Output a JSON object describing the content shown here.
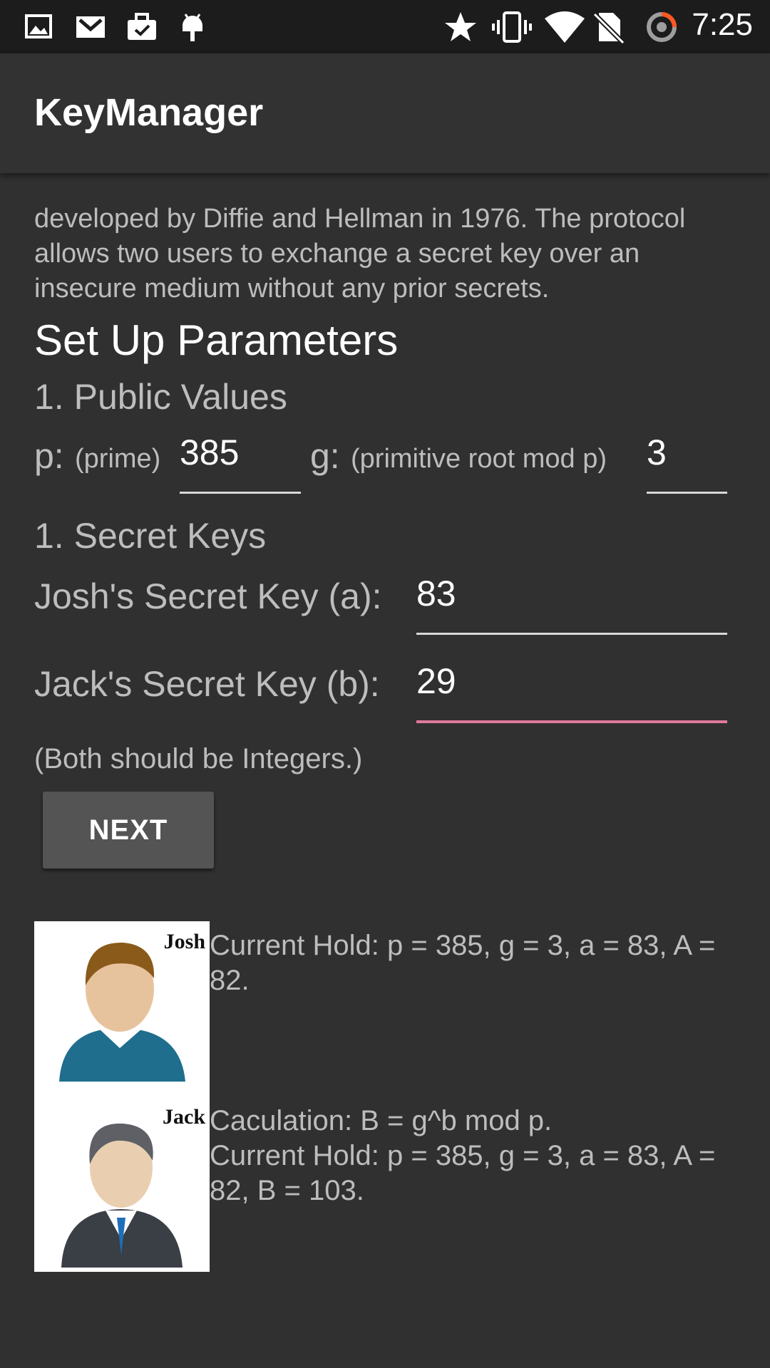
{
  "status_bar": {
    "time": "7:25",
    "left_icons": [
      "image-icon",
      "gmail-icon",
      "briefcase-check-icon",
      "android-icon"
    ],
    "right_icons": [
      "star-icon",
      "vibrate-icon",
      "wifi-icon",
      "no-sim-icon",
      "sync-icon"
    ]
  },
  "app_bar": {
    "title": "KeyManager"
  },
  "intro": {
    "text": "developed by Diffie and Hellman in 1976. The protocol allows two users to exchange a secret key over an insecure medium without any prior secrets."
  },
  "setup": {
    "heading": "Set Up Parameters",
    "public_heading": "1. Public Values",
    "p_label": "p:",
    "p_hint": "(prime)",
    "p_value": "385",
    "g_label": "g:",
    "g_hint": "(primitive root mod p)",
    "g_value": "3",
    "secret_heading": "1. Secret Keys",
    "josh_label": "Josh's Secret Key (a):",
    "josh_value": "83",
    "jack_label": "Jack's Secret Key (b):",
    "jack_value": "29",
    "hint": "(Both should be Integers.)",
    "next_label": "NEXT"
  },
  "josh": {
    "name": "Josh",
    "message": "Current Hold: p = 385, g = 3, a = 83, A = 82."
  },
  "jack": {
    "name": "Jack",
    "message_line1": "Caculation: B = g^b mod p.",
    "message_line2": "Current Hold: p = 385, g = 3, a = 83, A = 82, B = 103."
  },
  "colors": {
    "background": "#303030",
    "app_bar": "#323232",
    "status_bar": "#1c1c1c",
    "focus_accent": "#e07a9c",
    "button": "#545454"
  }
}
